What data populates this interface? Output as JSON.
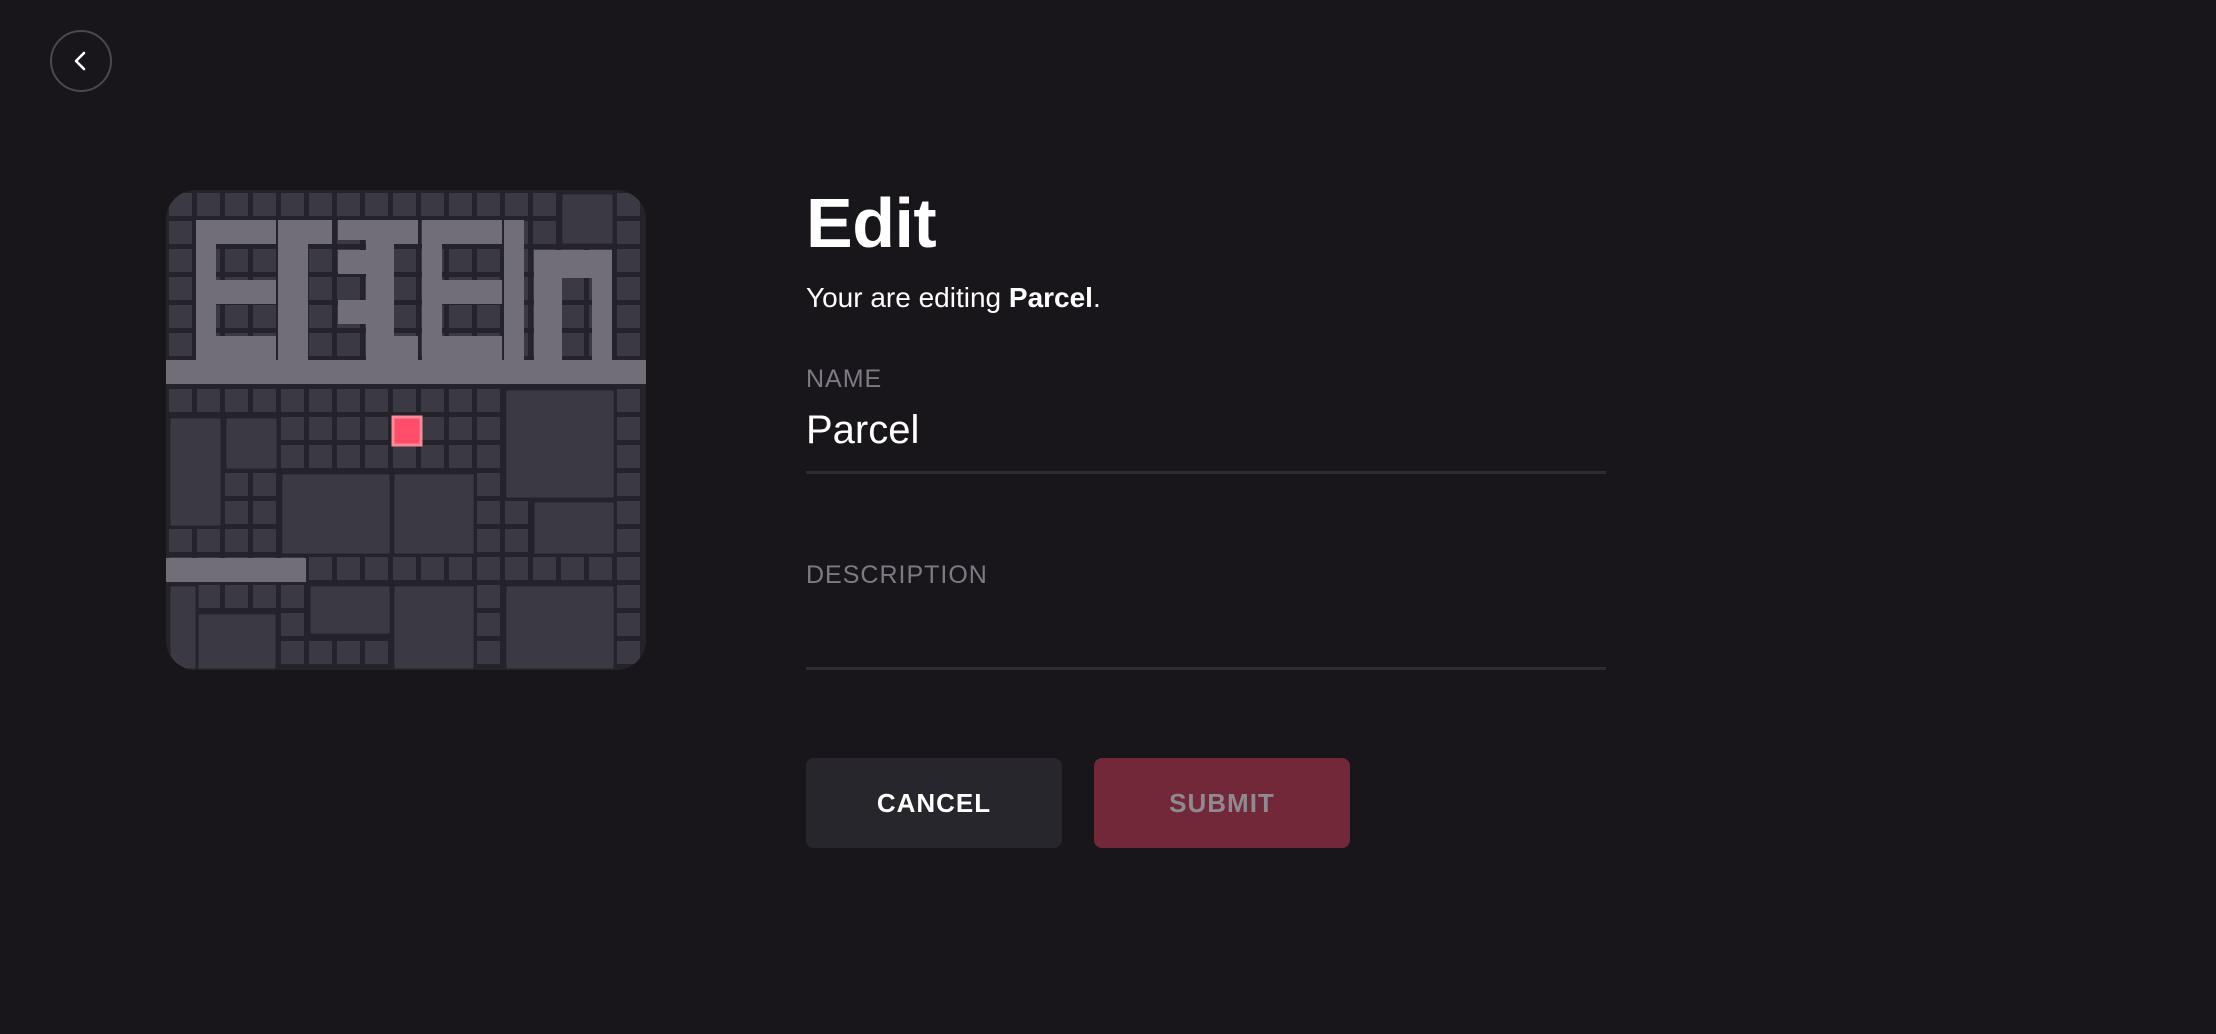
{
  "nav": {
    "back_icon": "chevron-left-icon"
  },
  "parcel_preview": {
    "highlight_color": "#ff4d6a",
    "tile_color": "#3b3942",
    "road_color": "#716e78",
    "grid_color": "#24222a"
  },
  "form": {
    "title": "Edit",
    "subtitle_prefix": "Your are editing ",
    "subtitle_name": "Parcel",
    "subtitle_suffix": ".",
    "name_label": "NAME",
    "name_value": "Parcel",
    "description_label": "DESCRIPTION",
    "description_value": ""
  },
  "actions": {
    "cancel_label": "CANCEL",
    "submit_label": "SUBMIT",
    "submit_color": "#73283a"
  }
}
